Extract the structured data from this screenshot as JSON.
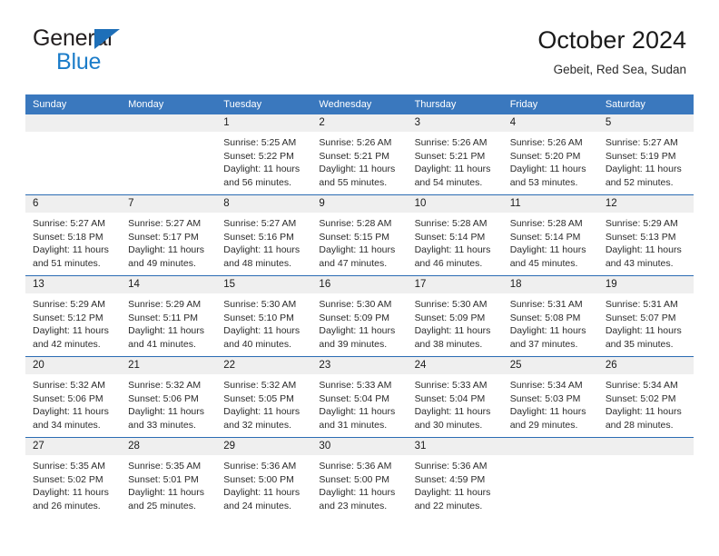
{
  "brand": {
    "line1": "General",
    "line2": "Blue",
    "flag_icon": "triangle-flag-icon",
    "color_dark": "#231f20",
    "color_blue": "#1b7cc9"
  },
  "header": {
    "title": "October 2024",
    "subtitle": "Gebeit, Red Sea, Sudan"
  },
  "theme": {
    "header_bg": "#3a78be",
    "row_rule": "#2b6cb3",
    "daynum_band": "#efefef"
  },
  "calendar": {
    "weekday_headers": [
      "Sunday",
      "Monday",
      "Tuesday",
      "Wednesday",
      "Thursday",
      "Friday",
      "Saturday"
    ],
    "weeks": [
      [
        {
          "day": "",
          "lines": []
        },
        {
          "day": "",
          "lines": []
        },
        {
          "day": "1",
          "lines": [
            "Sunrise: 5:25 AM",
            "Sunset: 5:22 PM",
            "Daylight: 11 hours",
            "and 56 minutes."
          ]
        },
        {
          "day": "2",
          "lines": [
            "Sunrise: 5:26 AM",
            "Sunset: 5:21 PM",
            "Daylight: 11 hours",
            "and 55 minutes."
          ]
        },
        {
          "day": "3",
          "lines": [
            "Sunrise: 5:26 AM",
            "Sunset: 5:21 PM",
            "Daylight: 11 hours",
            "and 54 minutes."
          ]
        },
        {
          "day": "4",
          "lines": [
            "Sunrise: 5:26 AM",
            "Sunset: 5:20 PM",
            "Daylight: 11 hours",
            "and 53 minutes."
          ]
        },
        {
          "day": "5",
          "lines": [
            "Sunrise: 5:27 AM",
            "Sunset: 5:19 PM",
            "Daylight: 11 hours",
            "and 52 minutes."
          ]
        }
      ],
      [
        {
          "day": "6",
          "lines": [
            "Sunrise: 5:27 AM",
            "Sunset: 5:18 PM",
            "Daylight: 11 hours",
            "and 51 minutes."
          ]
        },
        {
          "day": "7",
          "lines": [
            "Sunrise: 5:27 AM",
            "Sunset: 5:17 PM",
            "Daylight: 11 hours",
            "and 49 minutes."
          ]
        },
        {
          "day": "8",
          "lines": [
            "Sunrise: 5:27 AM",
            "Sunset: 5:16 PM",
            "Daylight: 11 hours",
            "and 48 minutes."
          ]
        },
        {
          "day": "9",
          "lines": [
            "Sunrise: 5:28 AM",
            "Sunset: 5:15 PM",
            "Daylight: 11 hours",
            "and 47 minutes."
          ]
        },
        {
          "day": "10",
          "lines": [
            "Sunrise: 5:28 AM",
            "Sunset: 5:14 PM",
            "Daylight: 11 hours",
            "and 46 minutes."
          ]
        },
        {
          "day": "11",
          "lines": [
            "Sunrise: 5:28 AM",
            "Sunset: 5:14 PM",
            "Daylight: 11 hours",
            "and 45 minutes."
          ]
        },
        {
          "day": "12",
          "lines": [
            "Sunrise: 5:29 AM",
            "Sunset: 5:13 PM",
            "Daylight: 11 hours",
            "and 43 minutes."
          ]
        }
      ],
      [
        {
          "day": "13",
          "lines": [
            "Sunrise: 5:29 AM",
            "Sunset: 5:12 PM",
            "Daylight: 11 hours",
            "and 42 minutes."
          ]
        },
        {
          "day": "14",
          "lines": [
            "Sunrise: 5:29 AM",
            "Sunset: 5:11 PM",
            "Daylight: 11 hours",
            "and 41 minutes."
          ]
        },
        {
          "day": "15",
          "lines": [
            "Sunrise: 5:30 AM",
            "Sunset: 5:10 PM",
            "Daylight: 11 hours",
            "and 40 minutes."
          ]
        },
        {
          "day": "16",
          "lines": [
            "Sunrise: 5:30 AM",
            "Sunset: 5:09 PM",
            "Daylight: 11 hours",
            "and 39 minutes."
          ]
        },
        {
          "day": "17",
          "lines": [
            "Sunrise: 5:30 AM",
            "Sunset: 5:09 PM",
            "Daylight: 11 hours",
            "and 38 minutes."
          ]
        },
        {
          "day": "18",
          "lines": [
            "Sunrise: 5:31 AM",
            "Sunset: 5:08 PM",
            "Daylight: 11 hours",
            "and 37 minutes."
          ]
        },
        {
          "day": "19",
          "lines": [
            "Sunrise: 5:31 AM",
            "Sunset: 5:07 PM",
            "Daylight: 11 hours",
            "and 35 minutes."
          ]
        }
      ],
      [
        {
          "day": "20",
          "lines": [
            "Sunrise: 5:32 AM",
            "Sunset: 5:06 PM",
            "Daylight: 11 hours",
            "and 34 minutes."
          ]
        },
        {
          "day": "21",
          "lines": [
            "Sunrise: 5:32 AM",
            "Sunset: 5:06 PM",
            "Daylight: 11 hours",
            "and 33 minutes."
          ]
        },
        {
          "day": "22",
          "lines": [
            "Sunrise: 5:32 AM",
            "Sunset: 5:05 PM",
            "Daylight: 11 hours",
            "and 32 minutes."
          ]
        },
        {
          "day": "23",
          "lines": [
            "Sunrise: 5:33 AM",
            "Sunset: 5:04 PM",
            "Daylight: 11 hours",
            "and 31 minutes."
          ]
        },
        {
          "day": "24",
          "lines": [
            "Sunrise: 5:33 AM",
            "Sunset: 5:04 PM",
            "Daylight: 11 hours",
            "and 30 minutes."
          ]
        },
        {
          "day": "25",
          "lines": [
            "Sunrise: 5:34 AM",
            "Sunset: 5:03 PM",
            "Daylight: 11 hours",
            "and 29 minutes."
          ]
        },
        {
          "day": "26",
          "lines": [
            "Sunrise: 5:34 AM",
            "Sunset: 5:02 PM",
            "Daylight: 11 hours",
            "and 28 minutes."
          ]
        }
      ],
      [
        {
          "day": "27",
          "lines": [
            "Sunrise: 5:35 AM",
            "Sunset: 5:02 PM",
            "Daylight: 11 hours",
            "and 26 minutes."
          ]
        },
        {
          "day": "28",
          "lines": [
            "Sunrise: 5:35 AM",
            "Sunset: 5:01 PM",
            "Daylight: 11 hours",
            "and 25 minutes."
          ]
        },
        {
          "day": "29",
          "lines": [
            "Sunrise: 5:36 AM",
            "Sunset: 5:00 PM",
            "Daylight: 11 hours",
            "and 24 minutes."
          ]
        },
        {
          "day": "30",
          "lines": [
            "Sunrise: 5:36 AM",
            "Sunset: 5:00 PM",
            "Daylight: 11 hours",
            "and 23 minutes."
          ]
        },
        {
          "day": "31",
          "lines": [
            "Sunrise: 5:36 AM",
            "Sunset: 4:59 PM",
            "Daylight: 11 hours",
            "and 22 minutes."
          ]
        },
        {
          "day": "",
          "lines": []
        },
        {
          "day": "",
          "lines": []
        }
      ]
    ]
  }
}
